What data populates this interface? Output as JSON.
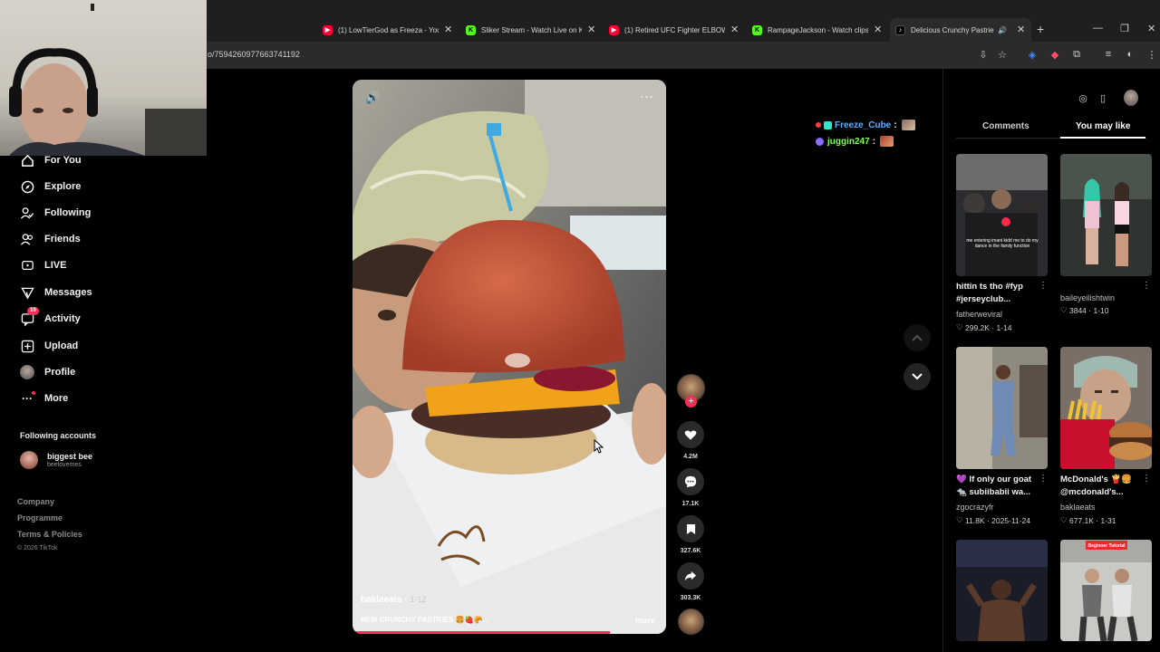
{
  "browser": {
    "tabs": [
      {
        "title": "(1) LowTierGod as Freeza - You",
        "favicon": "youtube-icon"
      },
      {
        "title": "Sliker Stream - Watch Live on K",
        "favicon": "kick-icon"
      },
      {
        "title": "(1) Retired UFC Fighter ELBOW",
        "favicon": "youtube-icon"
      },
      {
        "title": "RampageJackson - Watch clips",
        "favicon": "kick-icon"
      },
      {
        "title": "Delicious Crunchy Pastries",
        "favicon": "tiktok-icon",
        "active": true
      }
    ],
    "url_fragment": "o/7594260977663741192"
  },
  "sidebar": {
    "items": [
      {
        "label": "For You",
        "icon": "home-icon"
      },
      {
        "label": "Explore",
        "icon": "compass-icon"
      },
      {
        "label": "Following",
        "icon": "following-icon"
      },
      {
        "label": "Friends",
        "icon": "friends-icon"
      },
      {
        "label": "LIVE",
        "icon": "live-icon"
      },
      {
        "label": "Messages",
        "icon": "messages-icon"
      },
      {
        "label": "Activity",
        "icon": "activity-icon",
        "badge": "19"
      },
      {
        "label": "Upload",
        "icon": "upload-icon"
      },
      {
        "label": "Profile",
        "icon": "profile-avatar"
      },
      {
        "label": "More",
        "icon": "more-icon"
      }
    ],
    "following_title": "Following accounts",
    "following": [
      {
        "name": "biggest bee",
        "handle": "beelovemes"
      }
    ],
    "footer_links": [
      "Company",
      "Programme",
      "Terms & Policies"
    ],
    "copyright": "© 2026 TikTok"
  },
  "video": {
    "author": "baklaeats",
    "date": "1-12",
    "caption": "NEW CRUNCHY PASTRIES 🍔🍓🥐...",
    "more_label": "more",
    "progress_fraction": 0.82
  },
  "actions": {
    "likes": "4.2M",
    "comments": "17.1K",
    "saves": "327.6K",
    "shares": "303.3K"
  },
  "chat": [
    {
      "user": "Freeze_Cube",
      "color": "#5fb0ff",
      "badge_color": "#2ee6c8"
    },
    {
      "user": "juggin247",
      "color": "#7fff5a",
      "badge_color": "#8a6cff"
    }
  ],
  "right_panel": {
    "tabs": [
      "Comments",
      "You may like"
    ],
    "active_tab": "You may like",
    "cards": [
      {
        "title": "hittin ts tho #fyp #jerseyclub...",
        "author": "fatherweviral",
        "likes": "299.2K",
        "date": "1-14",
        "thumb_text": "me entering imani kidd me to do my dance in the family function"
      },
      {
        "title": "",
        "author": "baileyeilishtwin",
        "likes": "3844",
        "date": "1-10"
      },
      {
        "title": "💜 If only our goat 🐀 subiibabii wa...",
        "author": "zgocrazyfr",
        "likes": "11.8K",
        "date": "2025-11-24"
      },
      {
        "title": "McDonald's 🍟🍔 @mcdonald's...",
        "author": "baklaeats",
        "likes": "677.1K",
        "date": "1-31"
      },
      {
        "title": "",
        "author": "",
        "likes": "",
        "date": ""
      },
      {
        "title": "",
        "author": "",
        "likes": "",
        "date": "",
        "thumb_text": "Beginner Tutorial"
      }
    ]
  }
}
